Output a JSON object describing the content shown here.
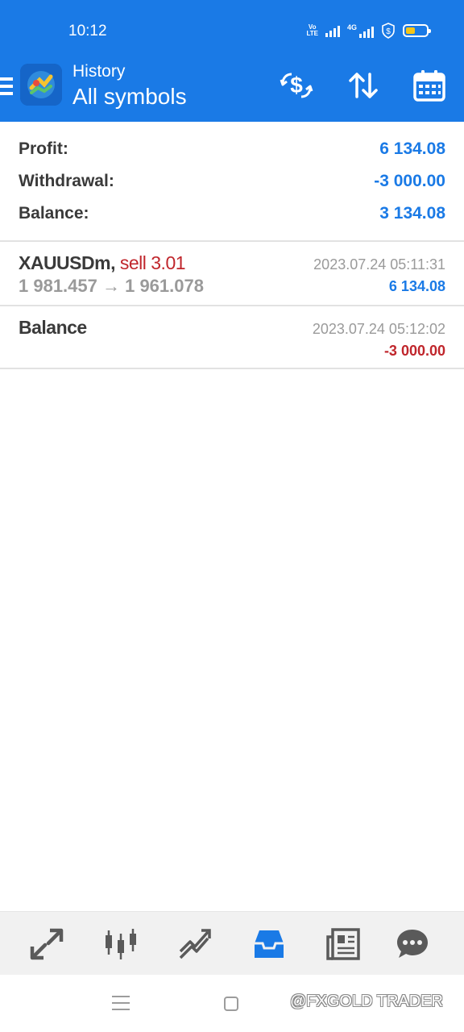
{
  "status_bar": {
    "time": "10:12",
    "volte_label": "Vo LTE",
    "network_label": "4G"
  },
  "header": {
    "subtitle": "History",
    "title": "All symbols",
    "icons": [
      "menu-icon",
      "app-logo",
      "dollar-exchange-icon",
      "sort-icon",
      "calendar-icon"
    ]
  },
  "summary": {
    "profit_label": "Profit:",
    "profit_value": "6 134.08",
    "withdrawal_label": "Withdrawal:",
    "withdrawal_value": "-3 000.00",
    "balance_label": "Balance:",
    "balance_value": "3 134.08"
  },
  "deals": [
    {
      "symbol": "XAUUSDm,",
      "action": "sell 3.01",
      "prices": "1 981.457 → 1 961.078",
      "time": "2023.07.24 05:11:31",
      "amount": "6 134.08"
    },
    {
      "symbol": "Balance",
      "time": "2023.07.24 05:12:02",
      "amount": "-3 000.00"
    }
  ],
  "tabbar": {
    "tabs": [
      "quotes-icon",
      "chart-candles-icon",
      "trade-icon",
      "history-icon",
      "news-icon",
      "chat-icon"
    ],
    "active_tab": "history-icon"
  },
  "watermark": "@FXGOLD TRADER",
  "colors": {
    "accent": "#1a7ae6",
    "negative": "#c0262c",
    "muted": "#9a9a9a",
    "text": "#3a3a3a"
  }
}
